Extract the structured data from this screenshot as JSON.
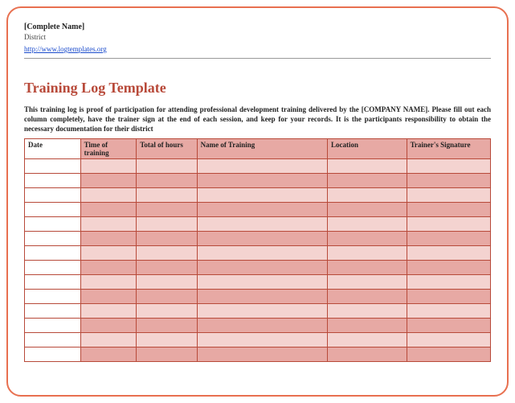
{
  "header": {
    "complete_name": "[Complete Name]",
    "district": "District",
    "url": "http://www.logtemplates.org"
  },
  "title": "Training Log Template",
  "intro": "This training log is proof of participation for attending professional development training delivered by the [COMPANY NAME]. Please fill out each column completely, have the trainer sign at the end of each session, and keep for your records. It is the participants responsibility to obtain the necessary documentation for their district",
  "columns": {
    "date": "Date",
    "time": "Time of training",
    "hours": "Total of hours",
    "name": "Name of Training",
    "location": "Location",
    "signature": "Trainer's Signature"
  },
  "row_count": 14
}
